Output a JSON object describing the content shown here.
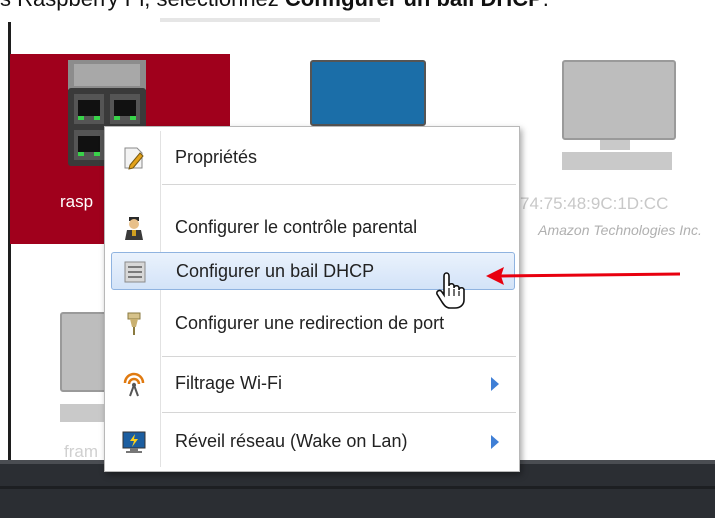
{
  "caption": {
    "prefix": "s Raspberry Pi, sélectionnez ",
    "bold": "Configurer un bail DHCP",
    "suffix": "."
  },
  "devices": {
    "selected_label": "rasp",
    "mac_label": "74:75:48:9C:1D:CC",
    "vendor_label": "Amazon Technologies Inc.",
    "fram_label": "fram"
  },
  "menu": {
    "items": [
      {
        "label": "Propriétés",
        "icon": "edit-document-icon",
        "submenu": false,
        "highlighted": false
      },
      {
        "label": "Configurer le contrôle parental",
        "icon": "parental-control-icon",
        "submenu": false,
        "highlighted": false
      },
      {
        "label": "Configurer un bail DHCP",
        "icon": "dhcp-lease-icon",
        "submenu": false,
        "highlighted": true
      },
      {
        "label": "Configurer une redirection de port",
        "icon": "port-forward-icon",
        "submenu": false,
        "highlighted": false
      },
      {
        "label": "Filtrage Wi-Fi",
        "icon": "wifi-icon",
        "submenu": true,
        "highlighted": false
      },
      {
        "label": "Réveil réseau (Wake on Lan)",
        "icon": "wake-on-lan-icon",
        "submenu": true,
        "highlighted": false
      }
    ]
  },
  "colors": {
    "selected_tile": "#a0001c",
    "highlight_border": "#8fb3e0",
    "arrow": "#e8000f",
    "submenu_arrow": "#3f7fd6"
  }
}
